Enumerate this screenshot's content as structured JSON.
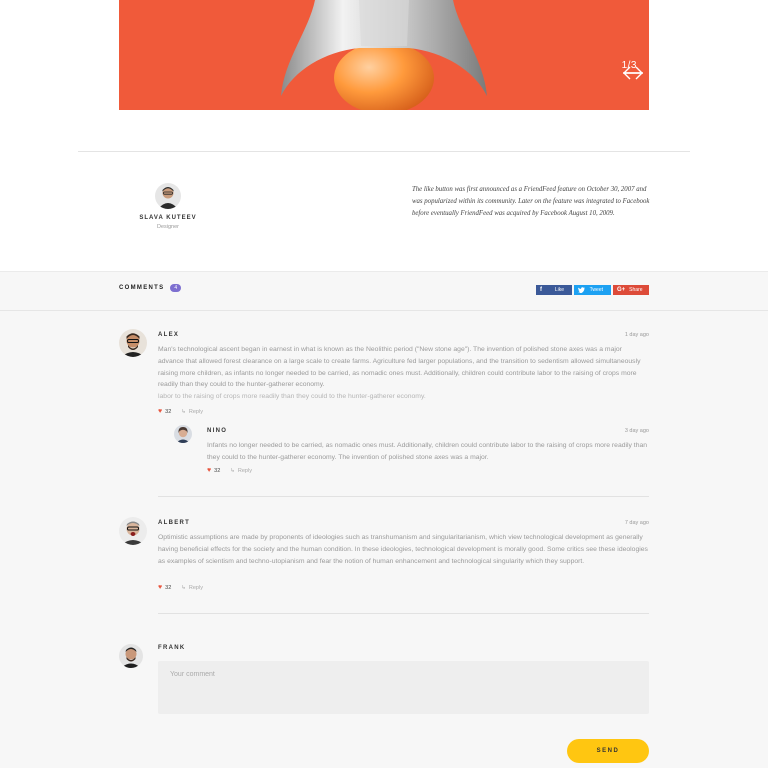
{
  "slider": {
    "counter": "1/3",
    "accent": "#f05a3a"
  },
  "author": {
    "name": "SLAVA KUTEEV",
    "role": "Designer",
    "quote": "The like button was first announced as a FriendFeed feature on October 30, 2007 and was popularized within its community. Later on the feature was integrated to Facebook before eventually FriendFeed was acquired by Facebook August 10, 2009."
  },
  "comments_header": {
    "title": "COMMENTS",
    "count": "4"
  },
  "share": {
    "facebook": {
      "icon": "f",
      "label": "Like",
      "color": "#3b5998"
    },
    "twitter": {
      "icon": "twitter-bird",
      "label": "Tweet",
      "color": "#1da1f2"
    },
    "google": {
      "icon": "G+",
      "label": "Share",
      "color": "#dd4b39"
    }
  },
  "comments": [
    {
      "author": "ALEX",
      "date": "1 day ago",
      "text": "Man's technological ascent began in earnest in what is known as the Neolithic period (\"New stone age\"). The invention of polished stone axes was a major advance that allowed forest clearance on a large scale to create farms. Agriculture fed larger populations, and the transition to sedentism allowed simultaneously raising more children, as infants no longer needed to be carried, as nomadic ones must. Additionally, children could contribute labor to the raising of crops more readily than they could to the hunter-gatherer economy.",
      "ghost": "labor to the raising of crops more readily than they could to the hunter-gatherer economy.",
      "likes": "32",
      "reply": "Reply"
    },
    {
      "author": "NINO",
      "date": "3 day ago",
      "text": "Infants no longer needed to be carried, as nomadic ones must. Additionally, children could contribute labor to the raising of crops more readily than they could to the hunter-gatherer economy. The invention of polished stone axes was a major.",
      "likes": "32",
      "reply": "Reply"
    },
    {
      "author": "ALBERT",
      "date": "7 day ago",
      "text": "Optimistic assumptions are made by proponents of ideologies such as transhumanism and singularitarianism, which view technological development as generally having beneficial effects for the society and the human condition. In these ideologies, technological development is morally good. Some critics see these ideologies as examples of scientism and techno-utopianism and fear the notion of human enhancement and technological singularity which they support.",
      "likes": "32",
      "reply": "Reply"
    }
  ],
  "new_comment": {
    "author": "FRANK",
    "placeholder": "Your comment",
    "send_label": "SEND"
  },
  "colors": {
    "heart": "#e8553e",
    "send_button": "#ffc611",
    "badge": "#7d6fd0"
  }
}
